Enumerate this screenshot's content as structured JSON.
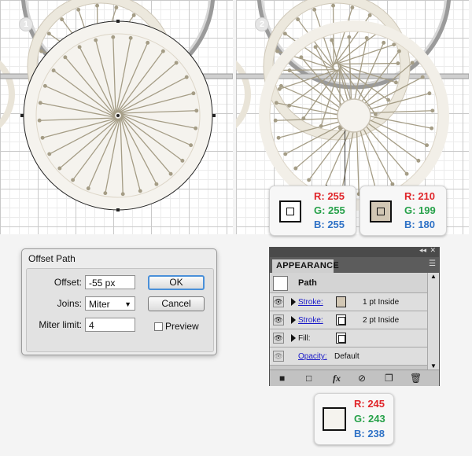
{
  "steps": [
    {
      "number": "1"
    },
    {
      "number": "2"
    }
  ],
  "color_cards": {
    "step2_white": {
      "r": "R: 255",
      "g": "G: 255",
      "b": "B: 255",
      "swatch": "#ffffff"
    },
    "step2_beige": {
      "r": "R: 210",
      "g": "G: 199",
      "b": "B: 180",
      "swatch": "#d2c7b4"
    },
    "panel_fill": {
      "r": "R: 245",
      "g": "G: 243",
      "b": "B: 238",
      "swatch": "#f5f3ee"
    }
  },
  "colors": {
    "red": "#e0262b",
    "green": "#27a14a",
    "blue": "#2f72c6",
    "spoke": "#a59d86",
    "rim": "#ece8dd"
  },
  "offset_dialog": {
    "title": "Offset Path",
    "offset_label": "Offset:",
    "offset_value": "-55 px",
    "joins_label": "Joins:",
    "joins_value": "Miter",
    "miter_label": "Miter limit:",
    "miter_value": "4",
    "ok": "OK",
    "cancel": "Cancel",
    "preview": "Preview"
  },
  "appearance": {
    "tab": "APPEARANCE",
    "item": "Path",
    "rows": [
      {
        "label": "Stroke:",
        "value": "1 pt  Inside",
        "swatch": "#d2c7b4"
      },
      {
        "label": "Stroke:",
        "value": "2 pt  Inside",
        "swatch": "#ffffff"
      },
      {
        "label": "Fill:",
        "value": "",
        "swatch": "#ffffff"
      }
    ],
    "opacity_label": "Opacity:",
    "opacity_value": "Default"
  }
}
